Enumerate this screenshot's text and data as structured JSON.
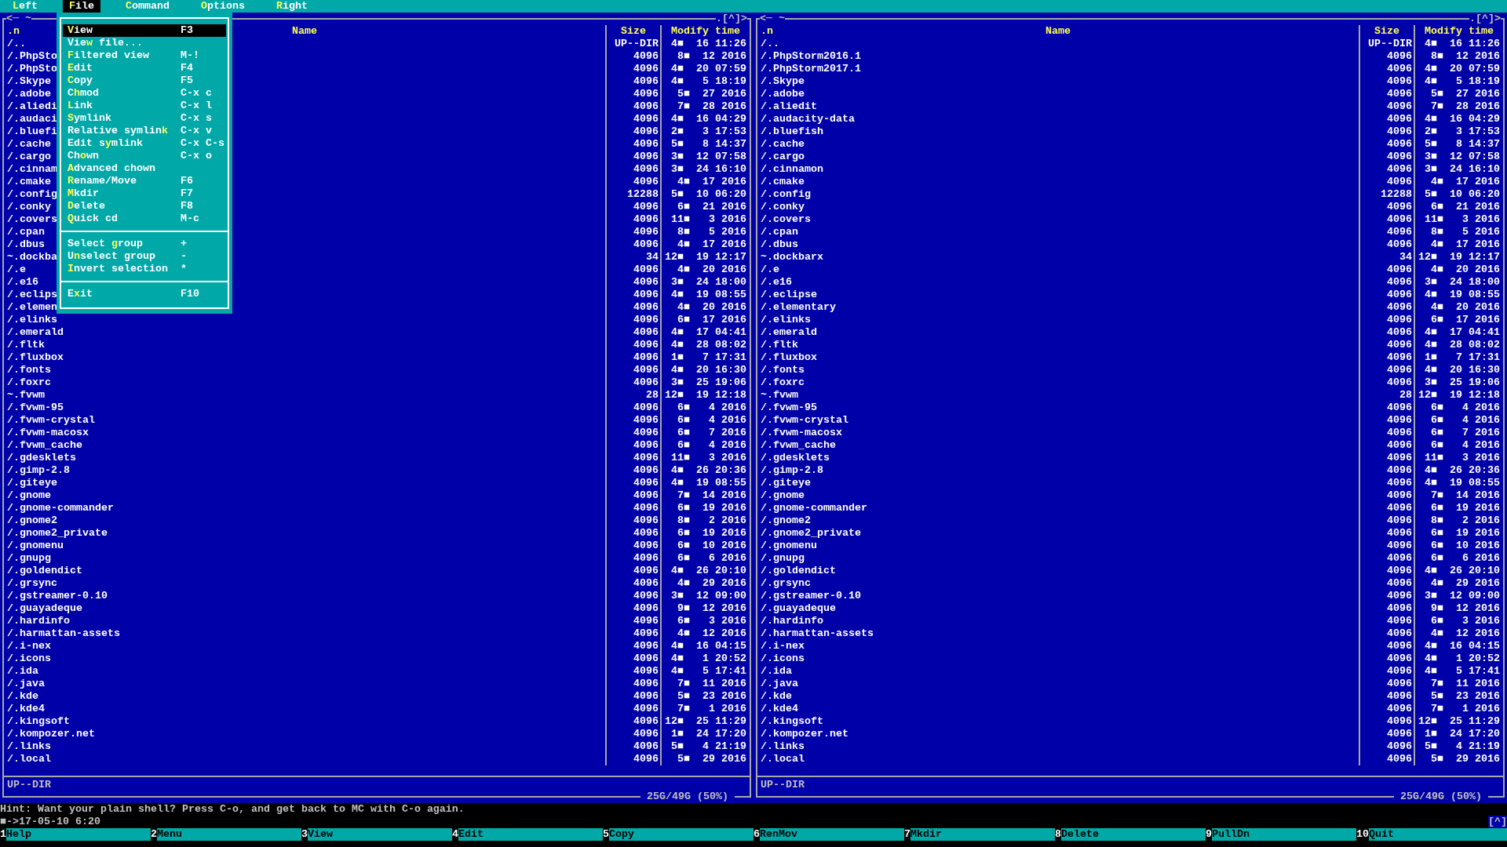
{
  "menu_bar": [
    {
      "label": "**L**eft",
      "selected": false
    },
    {
      "label": "**F**ile",
      "selected": true
    },
    {
      "label": "**C**ommand",
      "selected": false
    },
    {
      "label": "**O**ptions",
      "selected": false
    },
    {
      "label": "**R**ight",
      "selected": false
    }
  ],
  "file_menu": [
    {
      "kind": "item",
      "label": "**V**iew",
      "shortcut": "F3",
      "selected": true
    },
    {
      "kind": "item",
      "label": "Vie**w** file...",
      "selected": false
    },
    {
      "kind": "item",
      "label": "**F**iltered view",
      "shortcut": "M-!",
      "selected": false
    },
    {
      "kind": "item",
      "label": "**E**dit",
      "shortcut": "F4",
      "selected": false
    },
    {
      "kind": "item",
      "label": "**C**opy",
      "shortcut": "F5",
      "selected": false
    },
    {
      "kind": "item",
      "label": "C**h**mod",
      "shortcut": "C-x c",
      "selected": false
    },
    {
      "kind": "item",
      "label": "**L**ink",
      "shortcut": "C-x l",
      "selected": false
    },
    {
      "kind": "item",
      "label": "**S**ymlink",
      "shortcut": "C-x s",
      "selected": false
    },
    {
      "kind": "item",
      "label": "Relative symlin**k**",
      "shortcut": "C-x v",
      "selected": false
    },
    {
      "kind": "item",
      "label": "Edit s**y**mlink",
      "shortcut": "C-x C-s",
      "selected": false
    },
    {
      "kind": "item",
      "label": "Ch**o**wn",
      "shortcut": "C-x o",
      "selected": false
    },
    {
      "kind": "item",
      "label": "**A**dvanced chown",
      "selected": false
    },
    {
      "kind": "item",
      "label": "**R**ename/Move",
      "shortcut": "F6",
      "selected": false
    },
    {
      "kind": "item",
      "label": "**M**kdir",
      "shortcut": "F7",
      "selected": false
    },
    {
      "kind": "item",
      "label": "**D**elete",
      "shortcut": "F8",
      "selected": false
    },
    {
      "kind": "item",
      "label": "**Q**uick cd",
      "shortcut": "M-c",
      "selected": false
    },
    {
      "kind": "separator"
    },
    {
      "kind": "item",
      "label": "Select **g**roup",
      "shortcut": "+",
      "selected": false
    },
    {
      "kind": "item",
      "label": "U**n**select group",
      "shortcut": "-",
      "selected": false
    },
    {
      "kind": "item",
      "label": "**I**nvert selection",
      "shortcut": "*",
      "selected": false
    },
    {
      "kind": "separator"
    },
    {
      "kind": "item",
      "label": "E**x**it",
      "shortcut": "F10",
      "selected": false
    }
  ],
  "panels": [
    {
      "path_mark": "<─ ~",
      "history_mark": ".[^]>",
      "headers": {
        "sort": ".n",
        "name": "Name",
        "size": "Size",
        "time": "Modify time"
      },
      "files": [
        {
          "name": "/..",
          "size": "UP--DIR",
          "time": "4■  16 11:26"
        },
        {
          "name": "/.PhpSto",
          "size": "4096",
          "time": " 8■  12 2016"
        },
        {
          "name": "/.PhpSto",
          "size": "4096",
          "time": "4■  20 07:59"
        },
        {
          "name": "/.Skype",
          "size": "4096",
          "time": "4■   5 18:19"
        },
        {
          "name": "/.adobe",
          "size": "4096",
          "time": " 5■  27 2016"
        },
        {
          "name": "/.aliedi",
          "size": "4096",
          "time": " 7■  28 2016"
        },
        {
          "name": "/.audaci",
          "size": "4096",
          "time": "4■  16 04:29"
        },
        {
          "name": "/.bluefi",
          "size": "4096",
          "time": "2■   3 17:53"
        },
        {
          "name": "/.cache",
          "size": "4096",
          "time": "5■   8 14:37"
        },
        {
          "name": "/.cargo",
          "size": "4096",
          "time": "3■  12 07:58"
        },
        {
          "name": "/.cinnam",
          "size": "4096",
          "time": "3■  24 16:10"
        },
        {
          "name": "/.cmake",
          "size": "4096",
          "time": " 4■  17 2016"
        },
        {
          "name": "/.config",
          "size": "12288",
          "time": "5■  10 06:20"
        },
        {
          "name": "/.conky",
          "size": "4096",
          "time": " 6■  21 2016"
        },
        {
          "name": "/.covers",
          "size": "4096",
          "time": "11■   3 2016"
        },
        {
          "name": "/.cpan",
          "size": "4096",
          "time": " 8■   5 2016"
        },
        {
          "name": "/.dbus",
          "size": "4096",
          "time": " 4■  17 2016"
        },
        {
          "name": "~.dockba",
          "size": "34",
          "time": "12■  19 12:17"
        },
        {
          "name": "/.e",
          "size": "4096",
          "time": " 4■  20 2016"
        },
        {
          "name": "/.e16",
          "size": "4096",
          "time": "3■  24 18:00"
        },
        {
          "name": "/.eclips",
          "size": "4096",
          "time": "4■  19 08:55"
        },
        {
          "name": "/.elemen",
          "size": "4096",
          "time": " 4■  20 2016"
        },
        {
          "name": "/.elinks",
          "size": "4096",
          "time": " 6■  17 2016"
        },
        {
          "name": "/.emerald",
          "size": "4096",
          "time": "4■  17 04:41"
        },
        {
          "name": "/.fltk",
          "size": "4096",
          "time": "4■  28 08:02"
        },
        {
          "name": "/.fluxbox",
          "size": "4096",
          "time": "1■   7 17:31"
        },
        {
          "name": "/.fonts",
          "size": "4096",
          "time": "4■  20 16:30"
        },
        {
          "name": "/.foxrc",
          "size": "4096",
          "time": "3■  25 19:06"
        },
        {
          "name": "~.fvwm",
          "size": "28",
          "time": "12■  19 12:18"
        },
        {
          "name": "/.fvwm-95",
          "size": "4096",
          "time": " 6■   4 2016"
        },
        {
          "name": "/.fvwm-crystal",
          "size": "4096",
          "time": " 6■   4 2016"
        },
        {
          "name": "/.fvwm-macosx",
          "size": "4096",
          "time": " 6■   7 2016"
        },
        {
          "name": "/.fvwm_cache",
          "size": "4096",
          "time": " 6■   4 2016"
        },
        {
          "name": "/.gdesklets",
          "size": "4096",
          "time": "11■   3 2016"
        },
        {
          "name": "/.gimp-2.8",
          "size": "4096",
          "time": "4■  26 20:36"
        },
        {
          "name": "/.giteye",
          "size": "4096",
          "time": "4■  19 08:55"
        },
        {
          "name": "/.gnome",
          "size": "4096",
          "time": " 7■  14 2016"
        },
        {
          "name": "/.gnome-commander",
          "size": "4096",
          "time": " 6■  19 2016"
        },
        {
          "name": "/.gnome2",
          "size": "4096",
          "time": " 8■   2 2016"
        },
        {
          "name": "/.gnome2_private",
          "size": "4096",
          "time": " 6■  19 2016"
        },
        {
          "name": "/.gnomenu",
          "size": "4096",
          "time": " 6■  10 2016"
        },
        {
          "name": "/.gnupg",
          "size": "4096",
          "time": " 6■   6 2016"
        },
        {
          "name": "/.goldendict",
          "size": "4096",
          "time": "4■  26 20:10"
        },
        {
          "name": "/.grsync",
          "size": "4096",
          "time": " 4■  29 2016"
        },
        {
          "name": "/.gstreamer-0.10",
          "size": "4096",
          "time": "3■  12 09:00"
        },
        {
          "name": "/.guayadeque",
          "size": "4096",
          "time": " 9■  12 2016"
        },
        {
          "name": "/.hardinfo",
          "size": "4096",
          "time": " 6■   3 2016"
        },
        {
          "name": "/.harmattan-assets",
          "size": "4096",
          "time": " 4■  12 2016"
        },
        {
          "name": "/.i-nex",
          "size": "4096",
          "time": "4■  16 04:15"
        },
        {
          "name": "/.icons",
          "size": "4096",
          "time": "4■   1 20:52"
        },
        {
          "name": "/.ida",
          "size": "4096",
          "time": "4■   5 17:41"
        },
        {
          "name": "/.java",
          "size": "4096",
          "time": " 7■  11 2016"
        },
        {
          "name": "/.kde",
          "size": "4096",
          "time": " 5■  23 2016"
        },
        {
          "name": "/.kde4",
          "size": "4096",
          "time": " 7■   1 2016"
        },
        {
          "name": "/.kingsoft",
          "size": "4096",
          "time": "12■  25 11:29"
        },
        {
          "name": "/.kompozer.net",
          "size": "4096",
          "time": "1■  24 17:20"
        },
        {
          "name": "/.links",
          "size": "4096",
          "time": "5■   4 21:19"
        },
        {
          "name": "/.local",
          "size": "4096",
          "time": " 5■  29 2016"
        }
      ],
      "mini_status": "UP--DIR",
      "disk_usage": "25G/49G (50%)"
    },
    {
      "path_mark": "<─ ~",
      "history_mark": ".[^]>",
      "headers": {
        "sort": ".n",
        "name": "Name",
        "size": "Size",
        "time": "Modify time"
      },
      "files": [
        {
          "name": "/..",
          "size": "UP--DIR",
          "time": "4■  16 11:26"
        },
        {
          "name": "/.PhpStorm2016.1",
          "size": "4096",
          "time": " 8■  12 2016"
        },
        {
          "name": "/.PhpStorm2017.1",
          "size": "4096",
          "time": "4■  20 07:59"
        },
        {
          "name": "/.Skype",
          "size": "4096",
          "time": "4■   5 18:19"
        },
        {
          "name": "/.adobe",
          "size": "4096",
          "time": " 5■  27 2016"
        },
        {
          "name": "/.aliedit",
          "size": "4096",
          "time": " 7■  28 2016"
        },
        {
          "name": "/.audacity-data",
          "size": "4096",
          "time": "4■  16 04:29"
        },
        {
          "name": "/.bluefish",
          "size": "4096",
          "time": "2■   3 17:53"
        },
        {
          "name": "/.cache",
          "size": "4096",
          "time": "5■   8 14:37"
        },
        {
          "name": "/.cargo",
          "size": "4096",
          "time": "3■  12 07:58"
        },
        {
          "name": "/.cinnamon",
          "size": "4096",
          "time": "3■  24 16:10"
        },
        {
          "name": "/.cmake",
          "size": "4096",
          "time": " 4■  17 2016"
        },
        {
          "name": "/.config",
          "size": "12288",
          "time": "5■  10 06:20"
        },
        {
          "name": "/.conky",
          "size": "4096",
          "time": " 6■  21 2016"
        },
        {
          "name": "/.covers",
          "size": "4096",
          "time": "11■   3 2016"
        },
        {
          "name": "/.cpan",
          "size": "4096",
          "time": " 8■   5 2016"
        },
        {
          "name": "/.dbus",
          "size": "4096",
          "time": " 4■  17 2016"
        },
        {
          "name": "~.dockbarx",
          "size": "34",
          "time": "12■  19 12:17"
        },
        {
          "name": "/.e",
          "size": "4096",
          "time": " 4■  20 2016"
        },
        {
          "name": "/.e16",
          "size": "4096",
          "time": "3■  24 18:00"
        },
        {
          "name": "/.eclipse",
          "size": "4096",
          "time": "4■  19 08:55"
        },
        {
          "name": "/.elementary",
          "size": "4096",
          "time": " 4■  20 2016"
        },
        {
          "name": "/.elinks",
          "size": "4096",
          "time": " 6■  17 2016"
        },
        {
          "name": "/.emerald",
          "size": "4096",
          "time": "4■  17 04:41"
        },
        {
          "name": "/.fltk",
          "size": "4096",
          "time": "4■  28 08:02"
        },
        {
          "name": "/.fluxbox",
          "size": "4096",
          "time": "1■   7 17:31"
        },
        {
          "name": "/.fonts",
          "size": "4096",
          "time": "4■  20 16:30"
        },
        {
          "name": "/.foxrc",
          "size": "4096",
          "time": "3■  25 19:06"
        },
        {
          "name": "~.fvwm",
          "size": "28",
          "time": "12■  19 12:18"
        },
        {
          "name": "/.fvwm-95",
          "size": "4096",
          "time": " 6■   4 2016"
        },
        {
          "name": "/.fvwm-crystal",
          "size": "4096",
          "time": " 6■   4 2016"
        },
        {
          "name": "/.fvwm-macosx",
          "size": "4096",
          "time": " 6■   7 2016"
        },
        {
          "name": "/.fvwm_cache",
          "size": "4096",
          "time": " 6■   4 2016"
        },
        {
          "name": "/.gdesklets",
          "size": "4096",
          "time": "11■   3 2016"
        },
        {
          "name": "/.gimp-2.8",
          "size": "4096",
          "time": "4■  26 20:36"
        },
        {
          "name": "/.giteye",
          "size": "4096",
          "time": "4■  19 08:55"
        },
        {
          "name": "/.gnome",
          "size": "4096",
          "time": " 7■  14 2016"
        },
        {
          "name": "/.gnome-commander",
          "size": "4096",
          "time": " 6■  19 2016"
        },
        {
          "name": "/.gnome2",
          "size": "4096",
          "time": " 8■   2 2016"
        },
        {
          "name": "/.gnome2_private",
          "size": "4096",
          "time": " 6■  19 2016"
        },
        {
          "name": "/.gnomenu",
          "size": "4096",
          "time": " 6■  10 2016"
        },
        {
          "name": "/.gnupg",
          "size": "4096",
          "time": " 6■   6 2016"
        },
        {
          "name": "/.goldendict",
          "size": "4096",
          "time": "4■  26 20:10"
        },
        {
          "name": "/.grsync",
          "size": "4096",
          "time": " 4■  29 2016"
        },
        {
          "name": "/.gstreamer-0.10",
          "size": "4096",
          "time": "3■  12 09:00"
        },
        {
          "name": "/.guayadeque",
          "size": "4096",
          "time": " 9■  12 2016"
        },
        {
          "name": "/.hardinfo",
          "size": "4096",
          "time": " 6■   3 2016"
        },
        {
          "name": "/.harmattan-assets",
          "size": "4096",
          "time": " 4■  12 2016"
        },
        {
          "name": "/.i-nex",
          "size": "4096",
          "time": "4■  16 04:15"
        },
        {
          "name": "/.icons",
          "size": "4096",
          "time": "4■   1 20:52"
        },
        {
          "name": "/.ida",
          "size": "4096",
          "time": "4■   5 17:41"
        },
        {
          "name": "/.java",
          "size": "4096",
          "time": " 7■  11 2016"
        },
        {
          "name": "/.kde",
          "size": "4096",
          "time": " 5■  23 2016"
        },
        {
          "name": "/.kde4",
          "size": "4096",
          "time": " 7■   1 2016"
        },
        {
          "name": "/.kingsoft",
          "size": "4096",
          "time": "12■  25 11:29"
        },
        {
          "name": "/.kompozer.net",
          "size": "4096",
          "time": "1■  24 17:20"
        },
        {
          "name": "/.links",
          "size": "4096",
          "time": "5■   4 21:19"
        },
        {
          "name": "/.local",
          "size": "4096",
          "time": " 5■  29 2016"
        }
      ],
      "mini_status": "UP--DIR",
      "disk_usage": "25G/49G (50%)"
    }
  ],
  "hint": "Hint: Want your plain shell? Press C-o, and get back to MC with C-o again.",
  "prompt": "■->17-05-10 6:20",
  "prompt_marker": "[^]",
  "function_keys": [
    {
      "key": "1",
      "label": "Help"
    },
    {
      "key": "2",
      "label": "Menu"
    },
    {
      "key": "3",
      "label": "View"
    },
    {
      "key": "4",
      "label": "Edit"
    },
    {
      "key": "5",
      "label": "Copy"
    },
    {
      "key": "6",
      "label": "RenMov"
    },
    {
      "key": "7",
      "label": "Mkdir"
    },
    {
      "key": "8",
      "label": "Delete"
    },
    {
      "key": "9",
      "label": "PullDn"
    },
    {
      "key": "10",
      "label": "Quit"
    }
  ]
}
